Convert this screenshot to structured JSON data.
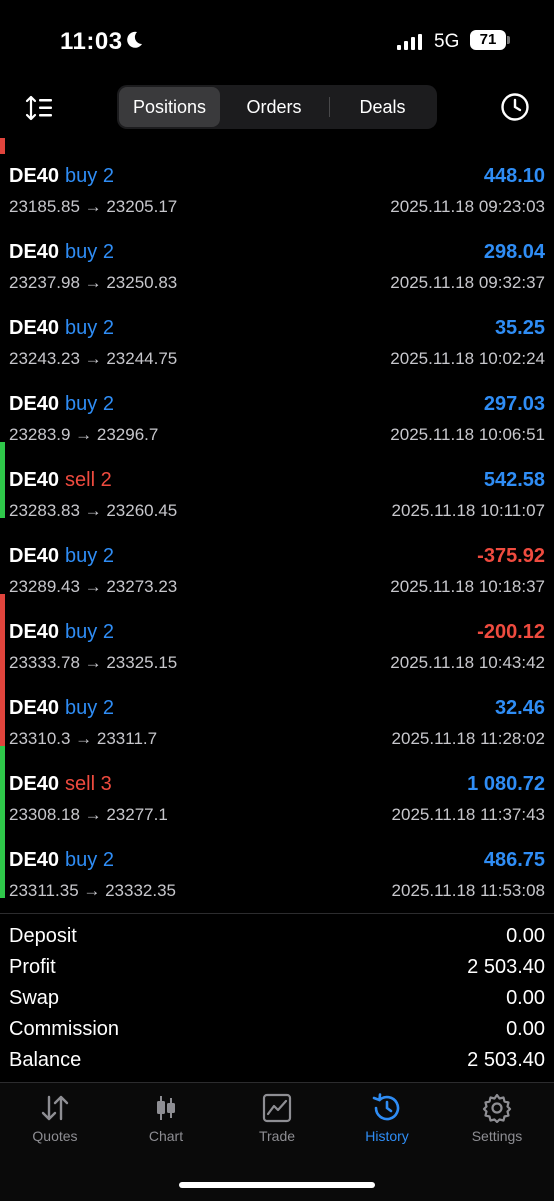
{
  "status_bar": {
    "time": "11:03",
    "network": "5G",
    "battery": "71"
  },
  "tabs": [
    {
      "label": "Positions",
      "active": true
    },
    {
      "label": "Orders",
      "active": false
    },
    {
      "label": "Deals",
      "active": false
    }
  ],
  "deals": [
    {
      "symbol": "DE40",
      "side": "buy",
      "volume": "2",
      "profit": "448.10",
      "prices": "23185.85 → 23205.17",
      "time": "2025.11.18 09:23:03",
      "bar": ""
    },
    {
      "symbol": "DE40",
      "side": "buy",
      "volume": "2",
      "profit": "298.04",
      "prices": "23237.98 → 23250.83",
      "time": "2025.11.18 09:32:37",
      "bar": ""
    },
    {
      "symbol": "DE40",
      "side": "buy",
      "volume": "2",
      "profit": "35.25",
      "prices": "23243.23 → 23244.75",
      "time": "2025.11.18 10:02:24",
      "bar": ""
    },
    {
      "symbol": "DE40",
      "side": "buy",
      "volume": "2",
      "profit": "297.03",
      "prices": "23283.9 → 23296.7",
      "time": "2025.11.18 10:06:51",
      "bar": ""
    },
    {
      "symbol": "DE40",
      "side": "sell",
      "volume": "2",
      "profit": "542.58",
      "prices": "23283.83 → 23260.45",
      "time": "2025.11.18 10:11:07",
      "bar": "#2fc84a"
    },
    {
      "symbol": "DE40",
      "side": "buy",
      "volume": "2",
      "profit": "-375.92",
      "prices": "23289.43 → 23273.23",
      "time": "2025.11.18 10:18:37",
      "bar": ""
    },
    {
      "symbol": "DE40",
      "side": "buy",
      "volume": "2",
      "profit": "-200.12",
      "prices": "23333.78 → 23325.15",
      "time": "2025.11.18 10:43:42",
      "bar": "#e0443c"
    },
    {
      "symbol": "DE40",
      "side": "buy",
      "volume": "2",
      "profit": "32.46",
      "prices": "23310.3 → 23311.7",
      "time": "2025.11.18 11:28:02",
      "bar": "#e0443c"
    },
    {
      "symbol": "DE40",
      "side": "sell",
      "volume": "3",
      "profit": "1 080.72",
      "prices": "23308.18 → 23277.1",
      "time": "2025.11.18 11:37:43",
      "bar": "#2fc84a"
    },
    {
      "symbol": "DE40",
      "side": "buy",
      "volume": "2",
      "profit": "486.75",
      "prices": "23311.35 → 23332.35",
      "time": "2025.11.18 11:53:08",
      "bar": "#2fc84a"
    }
  ],
  "summary": [
    {
      "label": "Deposit",
      "value": "0.00"
    },
    {
      "label": "Profit",
      "value": "2 503.40"
    },
    {
      "label": "Swap",
      "value": "0.00"
    },
    {
      "label": "Commission",
      "value": "0.00"
    },
    {
      "label": "Balance",
      "value": "2 503.40"
    }
  ],
  "tab_bar": [
    {
      "label": "Quotes",
      "icon": "quotes-icon",
      "active": false
    },
    {
      "label": "Chart",
      "icon": "chart-icon",
      "active": false
    },
    {
      "label": "Trade",
      "icon": "trade-icon",
      "active": false
    },
    {
      "label": "History",
      "icon": "history-icon",
      "active": true
    },
    {
      "label": "Settings",
      "icon": "gear-icon",
      "active": false
    }
  ],
  "colors": {
    "blue": "#2f8df5",
    "red": "#ef4b3f",
    "green": "#2fc84a",
    "bar_red": "#e0443c"
  }
}
